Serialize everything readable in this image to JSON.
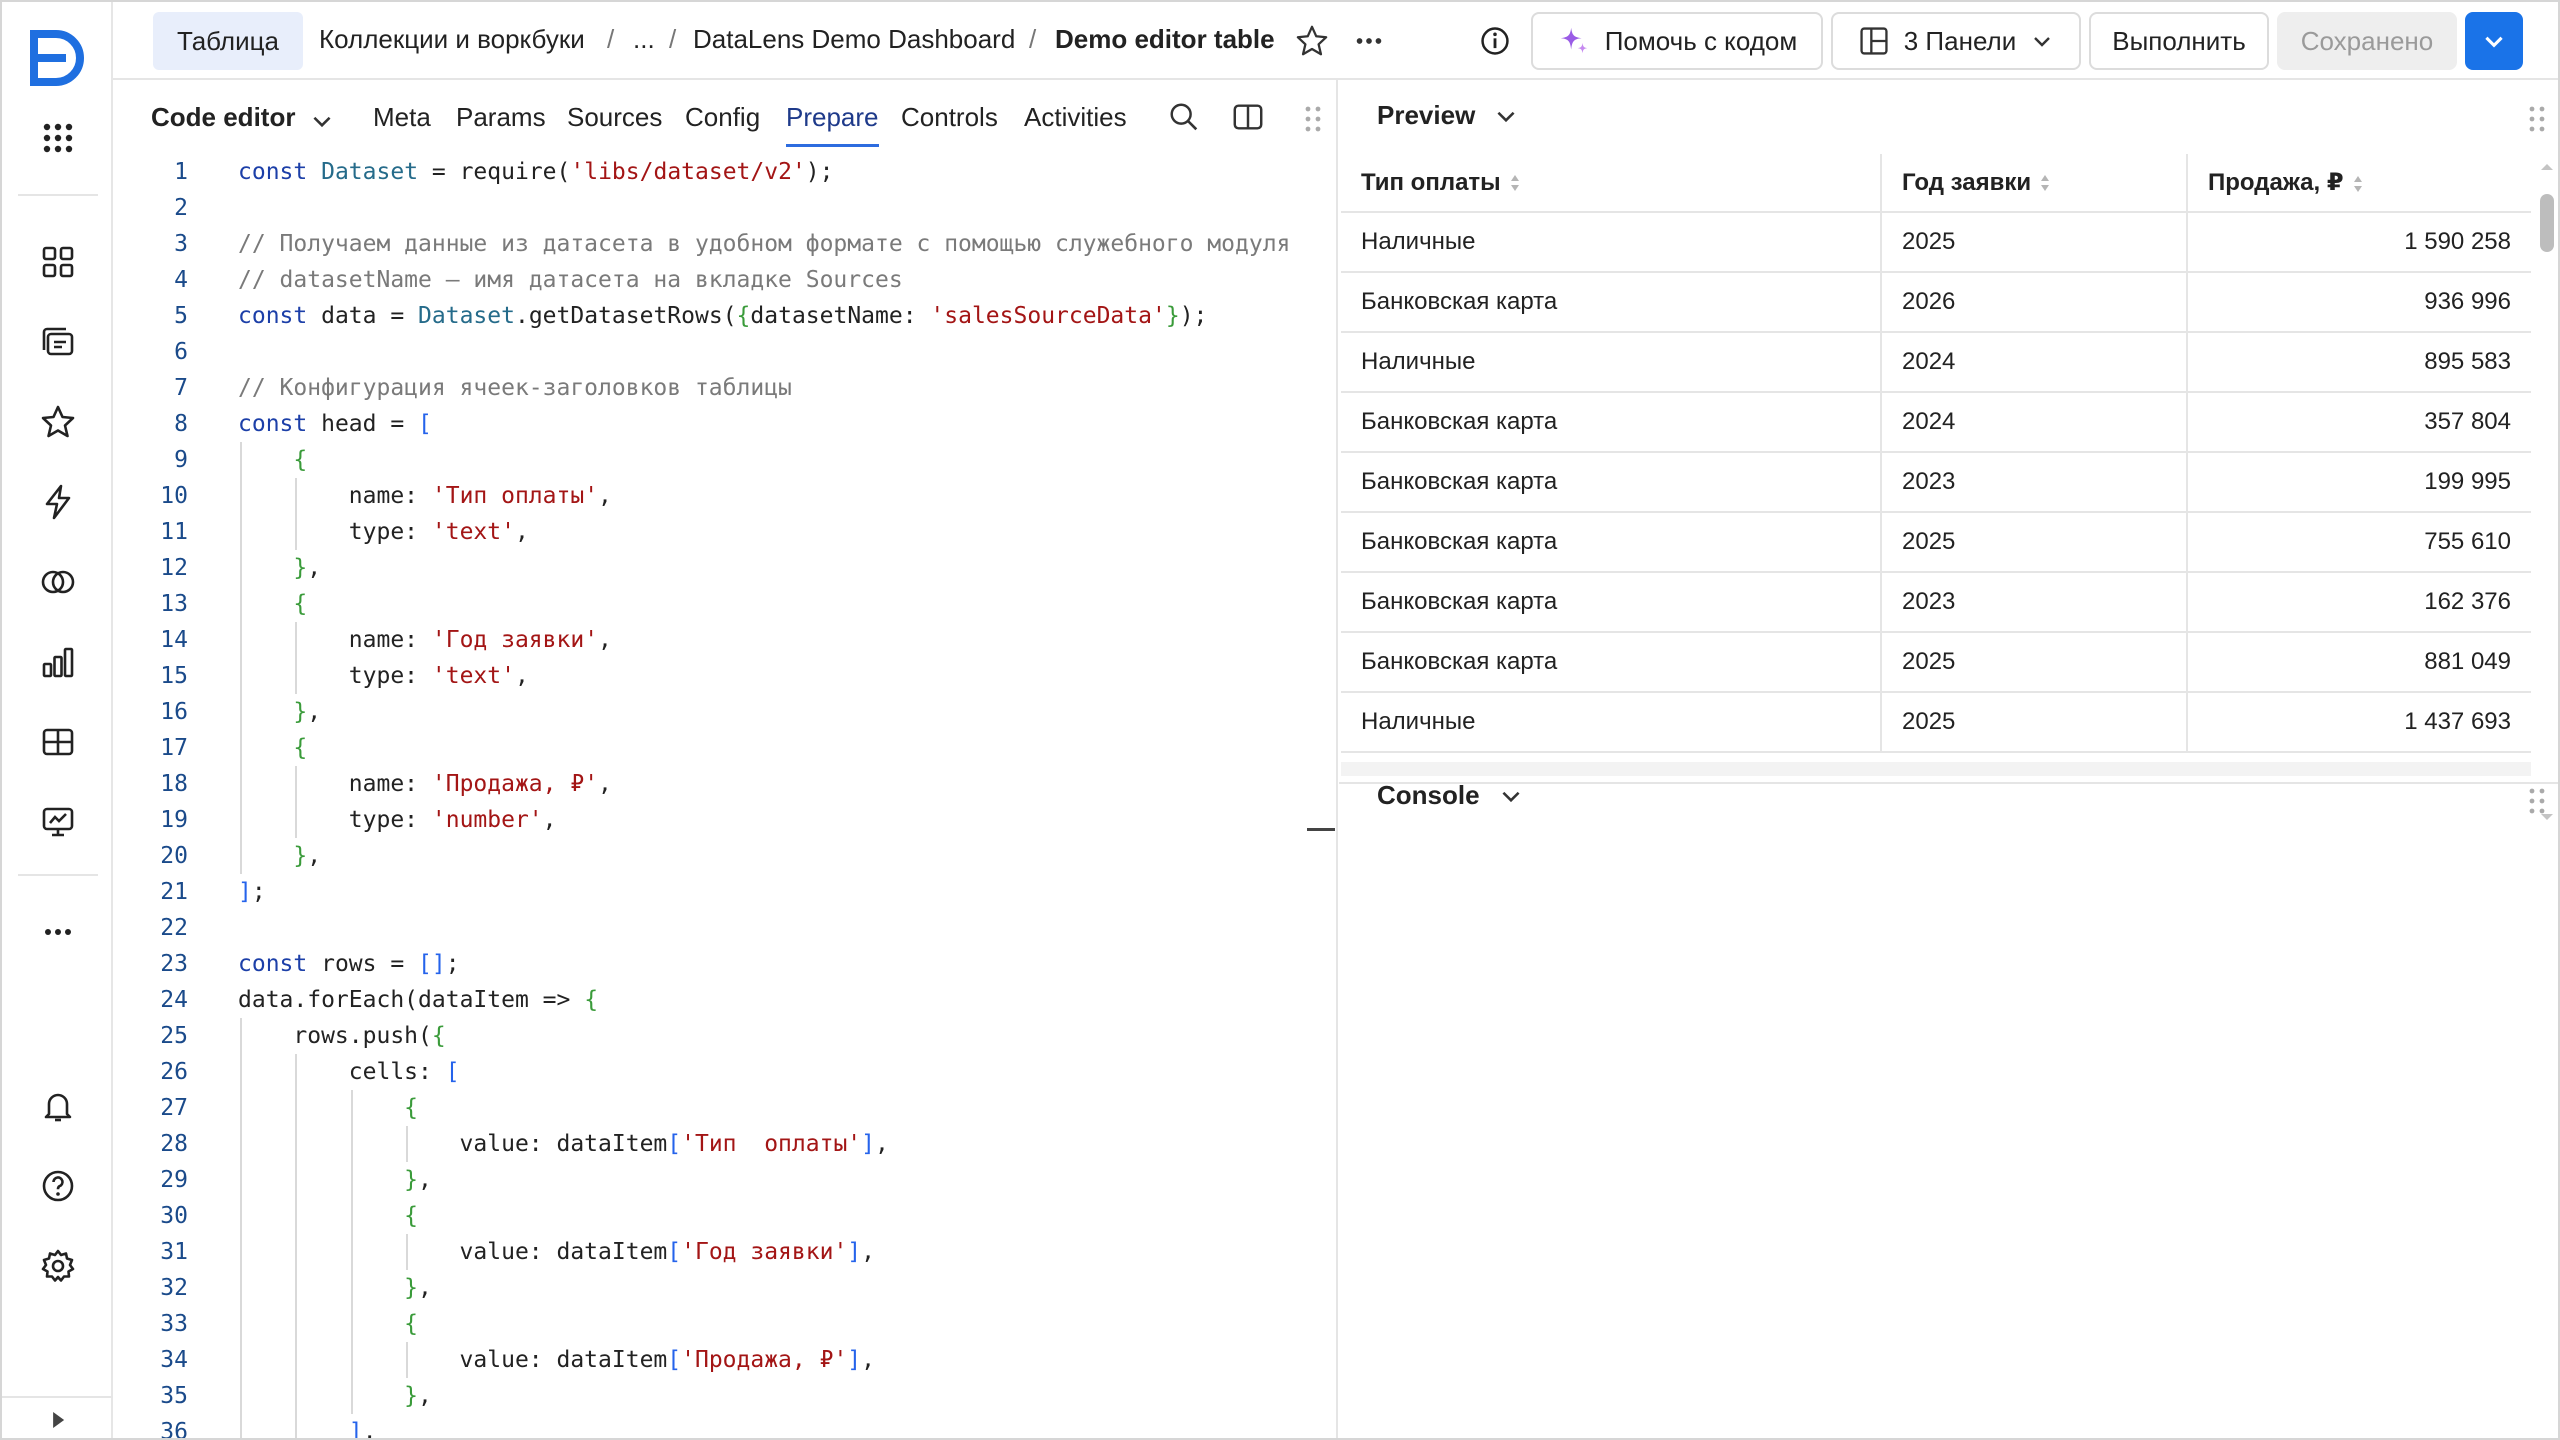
{
  "topbar": {
    "tab_label": "Таблица",
    "breadcrumb": [
      "Коллекции и воркбуки",
      "...",
      "DataLens Demo Dashboard"
    ],
    "current": "Demo editor table",
    "help_code": "Помочь с кодом",
    "panels": "3 Панели",
    "run": "Выполнить",
    "saved": "Сохранено"
  },
  "editor": {
    "title": "Code editor",
    "tabs": [
      "Meta",
      "Params",
      "Sources",
      "Config",
      "Prepare",
      "Controls",
      "Activities"
    ],
    "active_tab": "Prepare"
  },
  "code_lines": [
    "const Dataset = require('libs/dataset/v2');",
    "",
    "// Получаем данные из датасета в удобном формате с помощью служебного модуля",
    "// datasetName — имя датасета на вкладке Sources",
    "const data = Dataset.getDatasetRows({datasetName: 'salesSourceData'});",
    "",
    "// Конфигурация ячеек-заголовков таблицы",
    "const head = [",
    "    {",
    "        name: 'Тип оплаты',",
    "        type: 'text',",
    "    },",
    "    {",
    "        name: 'Год заявки',",
    "        type: 'text',",
    "    },",
    "    {",
    "        name: 'Продажа, ₽',",
    "        type: 'number',",
    "    },",
    "];",
    "",
    "const rows = [];",
    "data.forEach(dataItem => {",
    "    rows.push({",
    "        cells: [",
    "            {",
    "                value: dataItem['Тип  оплаты'],",
    "            },",
    "            {",
    "                value: dataItem['Год заявки'],",
    "            },",
    "            {",
    "                value: dataItem['Продажа, ₽'],",
    "            },",
    "        ],"
  ],
  "preview": {
    "title": "Preview",
    "columns": [
      "Тип оплаты",
      "Год заявки",
      "Продажа, ₽"
    ],
    "rows": [
      [
        "Наличные",
        "2025",
        "1 590 258"
      ],
      [
        "Банковская карта",
        "2026",
        "936 996"
      ],
      [
        "Наличные",
        "2024",
        "895 583"
      ],
      [
        "Банковская карта",
        "2024",
        "357 804"
      ],
      [
        "Банковская карта",
        "2023",
        "199 995"
      ],
      [
        "Банковская карта",
        "2025",
        "755 610"
      ],
      [
        "Банковская карта",
        "2023",
        "162 376"
      ],
      [
        "Банковская карта",
        "2025",
        "881 049"
      ],
      [
        "Наличные",
        "2025",
        "1 437 693"
      ]
    ]
  },
  "console": {
    "title": "Console"
  },
  "colors": {
    "accent": "#2d6cdf",
    "primary_button": "#1a73e8",
    "tab_bg": "#e8eefb",
    "logo": "#1f6fe0"
  }
}
